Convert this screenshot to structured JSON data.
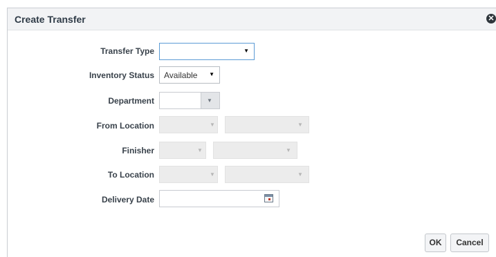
{
  "dialog": {
    "title": "Create Transfer",
    "close_icon": "close-icon"
  },
  "form": {
    "transfer_type": {
      "label": "Transfer Type",
      "value": ""
    },
    "inventory_status": {
      "label": "Inventory Status",
      "value": "Available"
    },
    "department": {
      "label": "Department",
      "value": ""
    },
    "from_location": {
      "label": "From Location"
    },
    "finisher": {
      "label": "Finisher"
    },
    "to_location": {
      "label": "To Location"
    },
    "delivery_date": {
      "label": "Delivery Date",
      "value": ""
    }
  },
  "buttons": {
    "ok": "OK",
    "cancel": "Cancel"
  },
  "colors": {
    "focus_border": "#5b9bd5",
    "disabled_bg": "#ececec",
    "title_bg": "#f2f3f5"
  }
}
